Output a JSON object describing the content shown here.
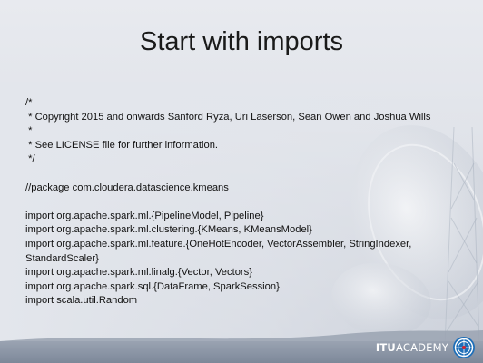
{
  "slide": {
    "title": "Start with imports",
    "code_lines": [
      "/*",
      " * Copyright 2015 and onwards Sanford Ryza, Uri Laserson, Sean Owen and Joshua Wills",
      " *",
      " * See LICENSE file for further information.",
      " */",
      "",
      "//package com.cloudera.datascience.kmeans",
      "",
      "import org.apache.spark.ml.{PipelineModel, Pipeline}",
      "import org.apache.spark.ml.clustering.{KMeans, KMeansModel}",
      "import org.apache.spark.ml.feature.{OneHotEncoder, VectorAssembler, StringIndexer,",
      "StandardScaler}",
      "import org.apache.spark.ml.linalg.{Vector, Vectors}",
      "import org.apache.spark.sql.{DataFrame, SparkSession}",
      "import scala.util.Random"
    ]
  },
  "footer": {
    "logo_strong": "ITU",
    "logo_light": "ACADEMY",
    "emblem_icon": "itu-emblem-icon"
  },
  "colors": {
    "title": "#1a1a1a",
    "text": "#111111",
    "footer": "#8a94a5"
  }
}
